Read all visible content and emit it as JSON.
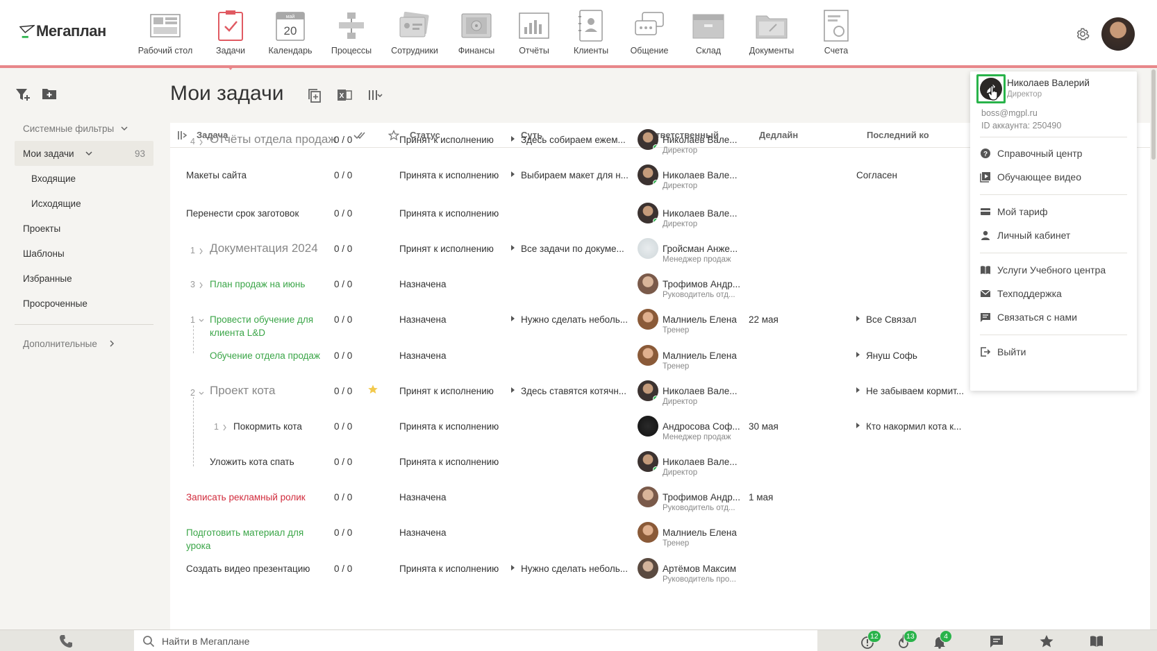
{
  "app": {
    "name": "Мегаплан"
  },
  "nav": [
    {
      "id": "desktop",
      "label": "Рабочий стол",
      "icon": "desktop-icon"
    },
    {
      "id": "tasks",
      "label": "Задачи",
      "icon": "tasks-icon",
      "active": true
    },
    {
      "id": "calendar",
      "label": "Календарь",
      "icon": "calendar-icon",
      "calendar_month": "май",
      "calendar_day": "20"
    },
    {
      "id": "processes",
      "label": "Процессы",
      "icon": "processes-icon"
    },
    {
      "id": "employees",
      "label": "Сотрудники",
      "icon": "employees-icon"
    },
    {
      "id": "finance",
      "label": "Финансы",
      "icon": "finance-icon"
    },
    {
      "id": "reports",
      "label": "Отчёты",
      "icon": "reports-icon"
    },
    {
      "id": "clients",
      "label": "Клиенты",
      "icon": "clients-icon"
    },
    {
      "id": "communication",
      "label": "Общение",
      "icon": "chat-icon"
    },
    {
      "id": "warehouse",
      "label": "Склад",
      "icon": "warehouse-icon"
    },
    {
      "id": "documents",
      "label": "Документы",
      "icon": "documents-icon"
    },
    {
      "id": "invoices",
      "label": "Счета",
      "icon": "invoices-icon"
    }
  ],
  "sidebar": {
    "system_filters": "Системные фильтры",
    "my_tasks": "Мои задачи",
    "my_tasks_count": "93",
    "incoming": "Входящие",
    "outgoing": "Исходящие",
    "projects": "Проекты",
    "templates": "Шаблоны",
    "favorites": "Избранные",
    "overdue": "Просроченные",
    "additional": "Дополнительные"
  },
  "page": {
    "title": "Мои задачи"
  },
  "table": {
    "headers": {
      "task": "Задача",
      "status": "Статус",
      "essence": "Суть",
      "responsible": "Ответственный",
      "deadline": "Дедлайн",
      "last_comment": "Последний ко"
    },
    "rows": [
      {
        "num": "4",
        "task": "Отчёты отдела продаж",
        "progress": "0 / 0",
        "status": "Принят к исполнению",
        "essence": "Здесь собираем ежем...",
        "resp": "Николаев Вале...",
        "role": "Директор",
        "deadline": "",
        "comment": ""
      },
      {
        "num": "",
        "task": "Макеты сайта",
        "progress": "0 / 0",
        "status": "Принята к исполнению",
        "essence": "Выбираем макет для н...",
        "resp": "Николаев Вале...",
        "role": "Директор",
        "deadline": "",
        "comment": "Согласен"
      },
      {
        "num": "",
        "task": "Перенести срок заготовок",
        "progress": "0 / 0",
        "status": "Принята к исполнению",
        "essence": "",
        "resp": "Николаев Вале...",
        "role": "Директор",
        "deadline": "",
        "comment": ""
      },
      {
        "num": "1",
        "task": "Документация 2024",
        "progress": "0 / 0",
        "status": "Принят к исполнению",
        "essence": "Все задачи по докуме...",
        "resp": "Гройсман Анже...",
        "role": "Менеджер продаж",
        "deadline": "",
        "comment": ""
      },
      {
        "num": "3",
        "task": "План продаж на июнь",
        "progress": "0 / 0",
        "status": "Назначена",
        "essence": "",
        "resp": "Трофимов Андр...",
        "role": "Руководитель отд...",
        "deadline": "",
        "comment": ""
      },
      {
        "num": "1",
        "task": "Провести обучение для",
        "task2": "клиента L&D",
        "progress": "0 / 0",
        "status": "Назначена",
        "essence": "Нужно сделать неболь...",
        "resp": "Малниель Елена",
        "role": "Тренер",
        "deadline": "22 мая",
        "comment": "Все Связал"
      },
      {
        "num": "",
        "task": "Обучение отдела продаж",
        "progress": "0 / 0",
        "status": "Назначена",
        "essence": "",
        "resp": "Малниель Елена",
        "role": "Тренер",
        "deadline": "",
        "comment": "Януш Софь"
      },
      {
        "num": "2",
        "task": "Проект кота",
        "progress": "0 / 0",
        "status": "Принят к исполнению",
        "essence": "Здесь ставятся котячн...",
        "resp": "Николаев Вале...",
        "role": "Директор",
        "deadline": "",
        "comment": "Не забываем кормит..."
      },
      {
        "num": "1",
        "task": "Покормить кота",
        "progress": "0 / 0",
        "status": "Принята к исполнению",
        "essence": "",
        "resp": "Андросова Соф...",
        "role": "Менеджер продаж",
        "deadline": "30 мая",
        "comment": "Кто накормил кота к..."
      },
      {
        "num": "",
        "task": "Уложить кота спать",
        "progress": "0 / 0",
        "status": "Принята к исполнению",
        "essence": "",
        "resp": "Николаев Вале...",
        "role": "Директор",
        "deadline": "",
        "comment": ""
      },
      {
        "num": "",
        "task": "Записать рекламный ролик",
        "progress": "0 / 0",
        "status": "Назначена",
        "essence": "",
        "resp": "Трофимов Андр...",
        "role": "Руководитель отд...",
        "deadline": "1 мая",
        "comment": ""
      },
      {
        "num": "",
        "task": "Подготовить материал для",
        "task2": "урока",
        "progress": "0 / 0",
        "status": "Назначена",
        "essence": "",
        "resp": "Малниель Елена",
        "role": "Тренер",
        "deadline": "",
        "comment": ""
      },
      {
        "num": "",
        "task": "Создать видео презентацию",
        "progress": "0 / 0",
        "status": "Принята к исполнению",
        "essence": "Нужно сделать неболь...",
        "resp": "Артёмов Максим",
        "role": "Руководитель про...",
        "deadline": "",
        "comment": ""
      }
    ]
  },
  "user_menu": {
    "name": "Николаев Валерий",
    "role": "Директор",
    "email": "boss@mgpl.ru",
    "account_id": "ID аккаунта: 250490",
    "help_center": "Справочный центр",
    "training_video": "Обучающее видео",
    "my_plan": "Мой тариф",
    "personal_cabinet": "Личный кабинет",
    "training_center": "Услуги Учебного центра",
    "support": "Техподдержка",
    "contact_us": "Связаться с нами",
    "logout": "Выйти"
  },
  "bottom": {
    "search_placeholder": "Найти в Мегаплане",
    "badge_alerts": "12",
    "badge_hot": "13",
    "badge_notifications": "4"
  },
  "colors": {
    "accent": "#e8878a",
    "green": "#29b34a",
    "task_green": "#3aa547",
    "task_red": "#d12b3c"
  }
}
